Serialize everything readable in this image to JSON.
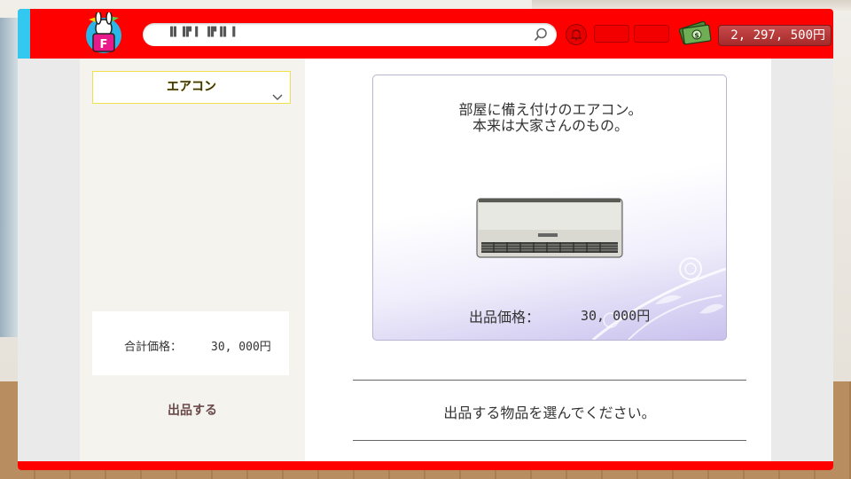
{
  "header": {
    "search_value": "▐▌▐▛▐ ▐▛▐▌▐",
    "wallet": {
      "amount": "2, 297, 500",
      "currency": "円"
    },
    "icons": [
      "app-logo-icon",
      "search-icon",
      "bell-icon",
      "money-icon"
    ]
  },
  "sidebar": {
    "category": "エアコン",
    "total_label": "合計価格：",
    "total_value": "30, 000円",
    "list_button": "出品する"
  },
  "item": {
    "description_line1": "部屋に備え付けのエアコン。",
    "description_line2": "本来は大家さんのもの。",
    "price_label": "出品価格：",
    "price_value": "30, 000円"
  },
  "prompt": "出品する物品を選んでください。",
  "colors": {
    "header_red": "#ff0000",
    "accent_blue": "#33c8f0",
    "category_border": "#f2e048",
    "wallet": "#b53838"
  }
}
